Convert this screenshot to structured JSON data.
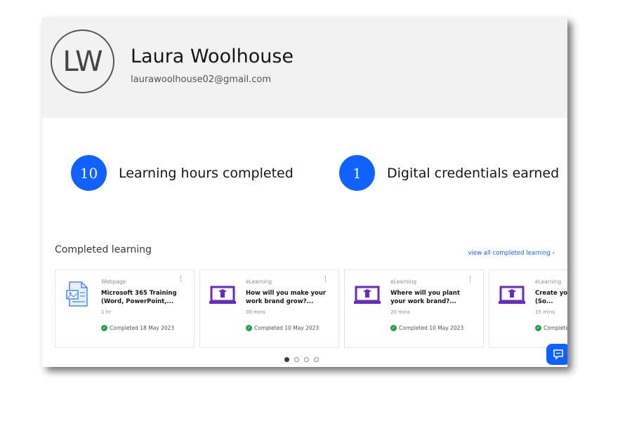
{
  "profile": {
    "initials": "LW",
    "name": "Laura Woolhouse",
    "email": "laurawoolhouse02@gmail.com"
  },
  "stats": [
    {
      "value": "10",
      "label": "Learning hours completed"
    },
    {
      "value": "1",
      "label": "Digital credentials earned"
    }
  ],
  "completed_learning": {
    "title": "Completed learning",
    "view_all": "view all completed learning  ›",
    "cards": [
      {
        "type": "Webpage",
        "title": "Microsoft 365 Training (Word, PowerPoint,...",
        "duration": "1 hr",
        "status": "Completed 18 May 2023",
        "icon": "document-icon"
      },
      {
        "type": "eLearning",
        "title": "How will you make your work brand grow?...",
        "duration": "30 mins",
        "status": "Completed 10 May 2023",
        "icon": "elearning-icon"
      },
      {
        "type": "eLearning",
        "title": "Where will you plant your work brand?...",
        "duration": "20 mins",
        "status": "Completed 10 May 2023",
        "icon": "elearning-icon"
      },
      {
        "type": "eLearning",
        "title": "Create your tagline (So...",
        "duration": "15 mins",
        "status": "Completed...",
        "icon": "elearning-icon"
      }
    ],
    "pagination": {
      "pages": 4,
      "current": 1
    }
  },
  "colors": {
    "accent": "#0f62fe",
    "success": "#24a148",
    "header_bg": "#f2f2f2",
    "elearning_icon": "#6929c4"
  }
}
